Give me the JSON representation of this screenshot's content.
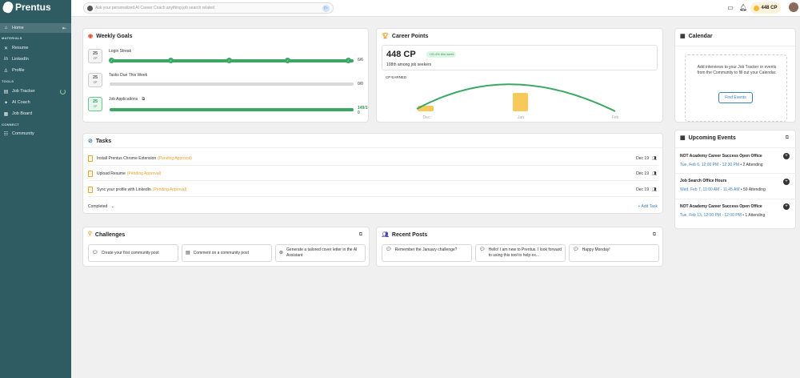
{
  "sidebar": {
    "brand": "Prentus",
    "home": "Home",
    "materials_label": "MATERIALS",
    "resume": "Resume",
    "linkedin": "LinkedIn",
    "profile": "Profile",
    "tools_label": "TOOLS",
    "job_tracker": "Job Tracker",
    "ai_coach": "AI Coach",
    "job_board": "Job Board",
    "connect_label": "CONNECT",
    "community": "Community"
  },
  "topbar": {
    "search_placeholder": "Ask your personalized AI Career Coach anything job search related",
    "cp": "448 CP"
  },
  "weekly_goals": {
    "title": "Weekly Goals",
    "goals": [
      {
        "points": "25",
        "unit": "CP",
        "label": "Login Streak",
        "count": "6/6",
        "progress": 1.0
      },
      {
        "points": "25",
        "unit": "CP",
        "label": "Tasks Due This Week",
        "count": "0/0",
        "progress": 0.0
      },
      {
        "points": "25",
        "unit": "CP",
        "label": "Job Applications",
        "count": "149/10",
        "progress": 1.0
      }
    ]
  },
  "career_points": {
    "title": "Career Points",
    "value": "448 CP",
    "delta": "+20.4% this week",
    "rank": "108th among job seekers",
    "earned_label": "CP EARNED",
    "months": [
      "Dec",
      "Jan",
      "Feb"
    ]
  },
  "tasks": {
    "title": "Tasks",
    "items": [
      {
        "name": "Install Prentus Chrome Extension",
        "status": "(Pending Approval)",
        "date": "Dec 19"
      },
      {
        "name": "Upload Resume",
        "status": "(Pending Approval)",
        "date": "Dec 19"
      },
      {
        "name": "Sync your profile with LinkedIn",
        "status": "(Pending Approval)",
        "date": "Dec 19"
      }
    ],
    "completed_label": "Completed",
    "add_label": "+ Add Task"
  },
  "challenges": {
    "title": "Challenges",
    "items": [
      "Create your first community post",
      "Comment on a community post",
      "Generate a tailored cover letter in the AI Assistant"
    ]
  },
  "recent_posts": {
    "title": "Recent Posts",
    "items": [
      "Remember the January challenge?",
      "Hello! I am new to Prentus. I look forward to using this tool to help ex...",
      "Happy Monday!"
    ]
  },
  "calendar": {
    "title": "Calendar",
    "empty_text": "Add interviews to your Job Tracker or events from the Community to fill out your Calendar.",
    "find_events": "Find Events"
  },
  "upcoming_events": {
    "title": "Upcoming Events",
    "items": [
      {
        "title": "NOT Academy Career Success Open Office",
        "time": "Tue, Feb 6, 12:00 PM - 12:30 PM",
        "attending": " • 2 Attending"
      },
      {
        "title": "Job Search Office Hours",
        "time": "Wed, Feb 7, 11:00 AM - 11:45 AM",
        "attending": " • 59 Attending"
      },
      {
        "title": "NOT Academy Career Success Open Office",
        "time": "Tue, Feb 13, 12:00 PM - 12:00 PM",
        "attending": " • 1 Attending"
      }
    ]
  },
  "colors": {
    "sidebar": "#2f5c62",
    "accent_green": "#3aa862",
    "pending_orange": "#e8a12b",
    "link_blue": "#3a7fc0",
    "bar_yellow": "#f7c85a"
  }
}
